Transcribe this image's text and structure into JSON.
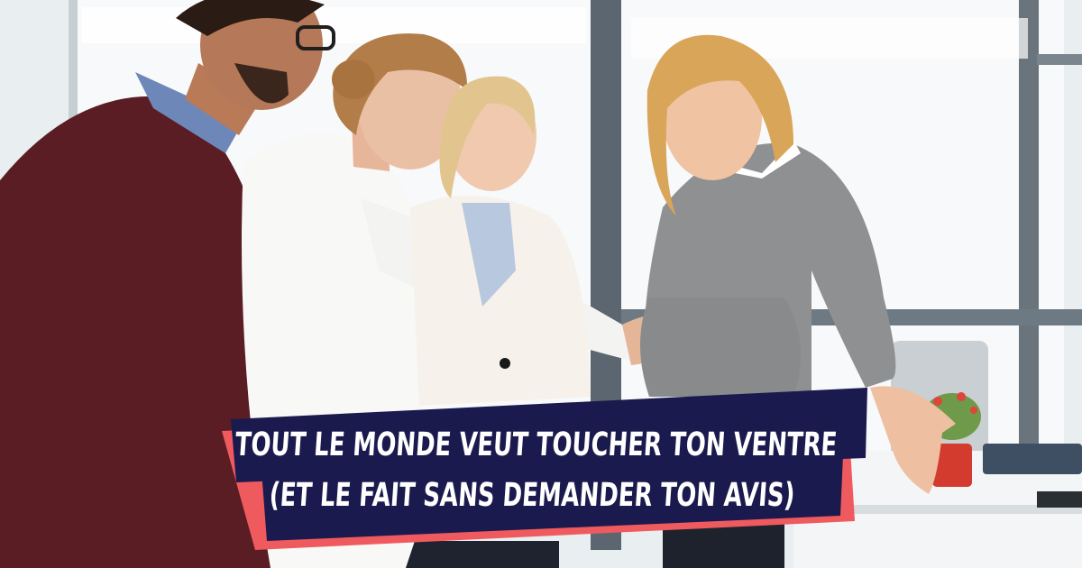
{
  "caption": {
    "line1": "TOUT LE MONDE VEUT TOUCHER TON VENTRE",
    "line2": "(ET LE FAIT SANS DEMANDER TON AVIS)"
  },
  "colors": {
    "banner_fill": "#1b1a4e",
    "banner_accent": "#ef5a5f",
    "caption_text": "#ffffff"
  }
}
